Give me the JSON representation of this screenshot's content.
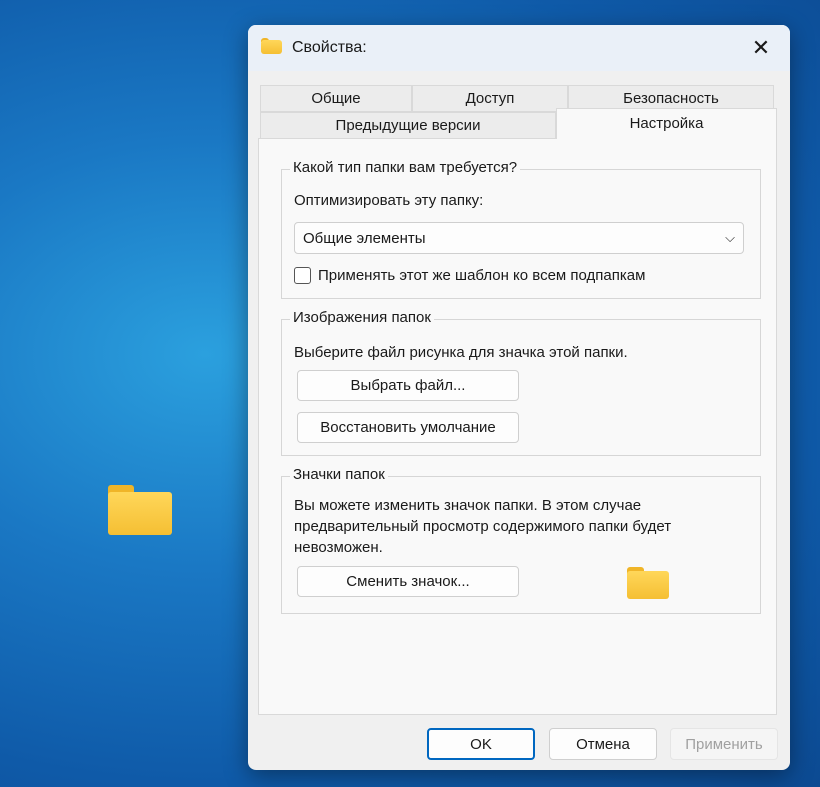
{
  "dialog": {
    "title": "Свойства:"
  },
  "tabs": {
    "row1": [
      "Общие",
      "Доступ",
      "Безопасность"
    ],
    "row2": [
      "Предыдущие версии",
      "Настройка"
    ],
    "selected": "Настройка"
  },
  "folder_type": {
    "legend": "Какой тип папки вам требуется?",
    "optimize_label": "Оптимизировать эту папку:",
    "selected": "Общие элементы",
    "apply_subfolders_label": "Применять этот же шаблон ко всем подпапкам",
    "apply_subfolders_checked": false
  },
  "folder_pictures": {
    "legend": "Изображения папок",
    "description": "Выберите файл рисунка для значка этой папки.",
    "choose_file": "Выбрать файл...",
    "restore_default": "Восстановить умолчание"
  },
  "folder_icons": {
    "legend": "Значки папок",
    "description": "Вы можете изменить значок папки. В этом случае предварительный просмотр содержимого папки будет невозможен.",
    "change_icon": "Сменить значок..."
  },
  "footer": {
    "ok": "OK",
    "cancel": "Отмена",
    "apply": "Применить"
  }
}
